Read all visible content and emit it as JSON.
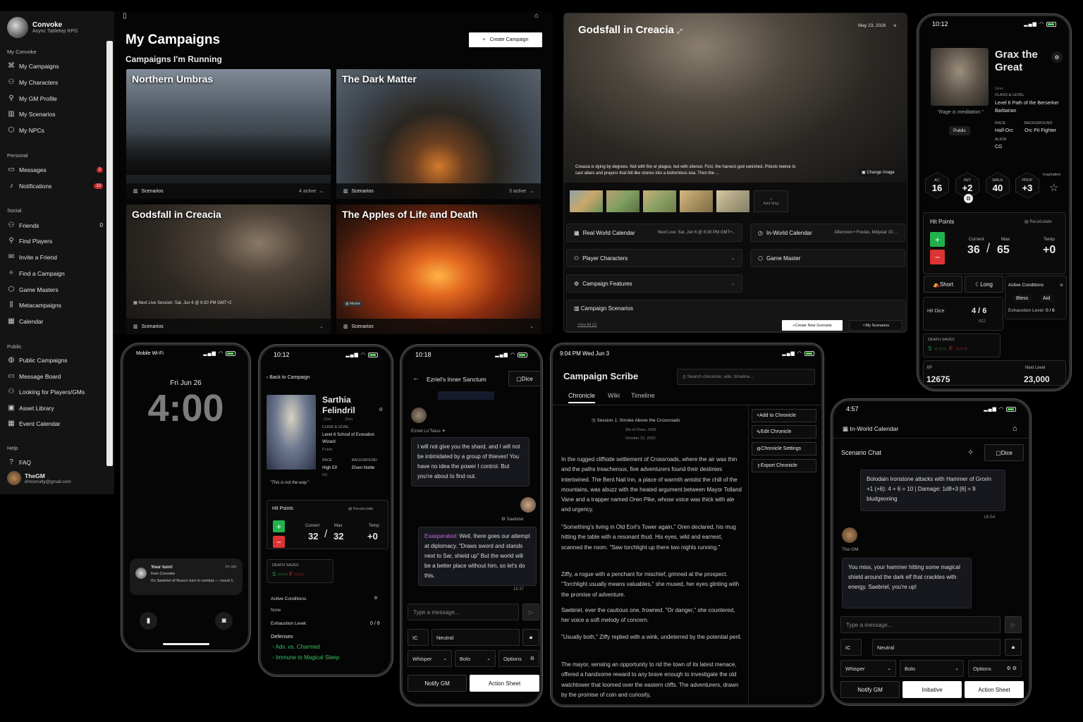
{
  "sidebar": {
    "brand": "Convoke",
    "tagline": "Async Tabletop RPG",
    "sec1": "My Convoke",
    "my": [
      "My Campaigns",
      "My Characters",
      "My GM Profile",
      "My Scenarios",
      "My NPCs"
    ],
    "sec2": "Personal",
    "messages": "Messages",
    "messages_badge": "2",
    "notifications": "Notifications",
    "notifications_badge": "10",
    "sec3": "Social",
    "friends": "Friends",
    "friends_count": "0",
    "social": [
      "Find Players",
      "Invite a Friend",
      "Find a Campaign",
      "Game Masters",
      "Metacampaigns",
      "Calendar"
    ],
    "sec4": "Public",
    "public": [
      "Public Campaigns",
      "Message Board",
      "Looking for Players/GMs",
      "Asset Library",
      "Event Calendar"
    ],
    "sec5": "Help",
    "faq": "FAQ",
    "user": "TheGM",
    "email": "dmcenulty@gmail.com"
  },
  "campaigns": {
    "title": "My Campaigns",
    "subtitle": "Campaigns I'm Running",
    "create": "Create Campaign",
    "cards": [
      {
        "name": "Northern Umbras",
        "footer": "Scenarios",
        "right": "4 active"
      },
      {
        "name": "The Dark Matter",
        "footer": "Scenarios",
        "right": "3 active"
      },
      {
        "name": "Godsfall in Creacia",
        "footer": "Scenarios",
        "session": "Next Live Session:  Sat, Jun 6 @ 6:30 PM GMT+2"
      },
      {
        "name": "The Apples of Life and Death",
        "footer": "Scenarios",
        "tag": "Home"
      }
    ]
  },
  "godfall": {
    "title": "Godsfall in Creacia",
    "date": "May 23, 2026",
    "desc": "Creacia is dying by degrees. Not with fire or plague, but with silence. First, the harvest god vanished. Priests twelve to cast altars and prayers that fell like stones into a bottomless sea. Then the ...",
    "change_image": "Change Image",
    "add_map": "Add Map",
    "rows": {
      "real_cal": "Real World Calendar",
      "real_cal_val": "Next Live: Sat, Jun 6 @ 6:30 PM GMT+..",
      "inworld": "In-World Calendar",
      "inworld_val": "Afternoon • Fredas, Midyear 10, ..",
      "pcs": "Player Characters",
      "gm": "Game Master",
      "features": "Campaign Features",
      "scenarios": "Campaign Scenarios",
      "view_all": "View All (1)",
      "create_scenario": "Create New Scenario",
      "my_scenarios": "My Scenarios"
    }
  },
  "grax": {
    "time": "10:12",
    "name": "Grax the Great",
    "sub": "Grax",
    "quote": "\"Rage is meditation.\"",
    "public": "Public",
    "class_label": "CLASS & LEVEL",
    "class": "Level 6 Path of the Berserker Barbarian",
    "race_label": "RACE",
    "race": "Half-Orc",
    "bg_label": "BACKGROUND",
    "bg": "Orc Pit Fighter",
    "align_label": "ALIGN",
    "align": "CG",
    "stats": [
      {
        "l": "AC",
        "v": "16"
      },
      {
        "l": "INIT",
        "v": "+2"
      },
      {
        "l": "WALK",
        "v": "40"
      },
      {
        "l": "PROF",
        "v": "+3"
      }
    ],
    "inspiration": "Inspiration",
    "hp_label": "Hit Points",
    "recalc": "Recalculate",
    "current_l": "Current",
    "max_l": "Max",
    "temp_l": "Temp",
    "current": "36",
    "max": "65",
    "temp": "+0",
    "short": "Short",
    "long": "Long",
    "active_cond": "Active Conditions",
    "conds": [
      "Bless",
      "Aid"
    ],
    "exh_label": "Exhaustion Level:",
    "exh": "0 / 6",
    "hit_dice": "Hit Dice",
    "hd": "4 / 6",
    "hd_die": "d12",
    "death": "DEATH SAVES",
    "xp_l": "XP",
    "xp": "12675",
    "next_l": "Next Level",
    "next": "23,000"
  },
  "lock": {
    "carrier": "Mobile Wi-Fi",
    "date": "Fri Jun 26",
    "time": "4:00",
    "notif_title": "Your turn!",
    "notif_ago": "1m ago",
    "notif_from": "from Convoke",
    "notif_body": "It's Saebriel of Ruos's turn in combat — round 1."
  },
  "sarthia": {
    "time": "10:12",
    "back": "Back to Campaign",
    "name": "Sarthia Felindril",
    "sub1": "(Sar)",
    "sub2": "(Sar)",
    "class_label": "CLASS & LEVEL",
    "class": "Level 6 School of Evocation Wizard",
    "pub": "Public",
    "race_label": "RACE",
    "race": "High Elf",
    "bg_label": "BACKGROUND",
    "bg": "Elven Noble",
    "align": "NG",
    "quote": "\"This is not the way.\"",
    "hp_label": "Hit Points",
    "recalc": "Recalculate",
    "current_l": "Current",
    "max_l": "Max",
    "temp_l": "Temp",
    "current": "32",
    "max": "32",
    "temp": "+0",
    "death": "DEATH SAVES",
    "active_cond": "Active Conditions",
    "none": "None",
    "exh_label": "Exhaustion Level:",
    "exh": "0 / 6",
    "defenses": "Defenses",
    "def": [
      "Adv. vs. Charmed",
      "Immune to Magical Sleep"
    ]
  },
  "sanctum": {
    "time": "10:18",
    "title": "Ezriel's Inner Sanctum",
    "dice": "Dice",
    "speaker1": "Ezriel Lo'Taius",
    "msg1": "I will not give you the shard, and I will not be intimidated by a group of thieves! You have no idea the power I control. But you're about to find out.",
    "speaker2": "Saebriel",
    "mood": "Exasperated:",
    "msg2": " Well, there goes our attempt at diplomacy. \"Draws sword and stands next to Sar, shield up\" But the world will be a better place without him, so let's do this.",
    "msg2_time": "16:37",
    "placeholder": "Type a message...",
    "ic": "IC",
    "neutral": "Neutral",
    "whisper": "Whisper",
    "bolo": "Bolo",
    "options": "Options",
    "notify": "Notify GM",
    "action": "Action Sheet"
  },
  "scribe": {
    "time": "9:04 PM  Wed Jun 3",
    "title": "Campaign Scribe",
    "search": "Search chronicle, wiki, timeline...",
    "tabs": [
      "Chronicle",
      "Wiki",
      "Timeline"
    ],
    "session": "Session 1: Smoke Above the Crossroads",
    "sdate1": "5th of Cheu, 1492",
    "sdate2": "October 15, 2023",
    "actions": [
      "Add to Chronicle",
      "Edit Chronicle",
      "Chronicle Settings",
      "Export Chronicle"
    ],
    "paras": [
      "In the rugged cliffside settlement of Crossroads, where the air was thin and the paths treacherous, five adventurers found their destinies intertwined. The Bent Nail Inn, a place of warmth amidst the chill of the mountains, was abuzz with the heated argument between Mayor Tolland Vane and a trapper named Oren Pike, whose voice was thick with ale and urgency.",
      "\"Something's living in Old Eorl's Tower again,\" Oren declared, his mug hitting the table with a resonant thud. His eyes, wild and earnest, scanned the room. \"Saw torchlight up there two nights running.\"",
      "Ziffy, a rogue with a penchant for mischief, grinned at the prospect. \"Torchlight usually means valuables,\" she mused, her eyes glinting with the promise of adventure.",
      "Saebriel, ever the cautious one, frowned. \"Or danger,\" she countered, her voice a soft melody of concern.",
      "\"Usually both,\" Ziffy replied with a wink, undeterred by the potential peril.",
      "The mayor, sensing an opportunity to rid the town of its latest menace, offered a handsome reward to any brave enough to investigate the old watchtower that loomed over the eastern cliffs. The adventurers, drawn by the promise of coin and curiosity,"
    ]
  },
  "chat": {
    "time": "4:57",
    "cal": "In-World Calendar",
    "title": "Scenario Chat",
    "dice": "Dice",
    "roll": "Bolodain Ironstone attacks with Hammer of Grorin +1 (+6): 4 + 6 = 10 | Damage: 1d8+3 [6]  =  9 bludgeoning",
    "roll_time": "16:54",
    "gm": "The GM",
    "gm_msg": "You miss, your hammer hitting some magical shield around the dark elf that crackles with energy. Saebriel, you're up!",
    "placeholder": "Type a message...",
    "ic": "IC",
    "neutral": "Neutral",
    "whisper": "Whisper",
    "bolo": "Bolo",
    "options": "Options",
    "notify": "Notify GM",
    "initiative": "Initiative",
    "action": "Action Sheet"
  }
}
